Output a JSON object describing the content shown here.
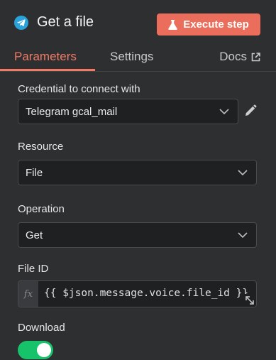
{
  "header": {
    "title": "Get a file",
    "node_icon": "telegram-icon",
    "execute_label": "Execute step",
    "execute_icon": "flask-icon",
    "accent": "#ea6e5b"
  },
  "tabs": [
    {
      "label": "Parameters",
      "active": true
    },
    {
      "label": "Settings",
      "active": false
    }
  ],
  "docs": {
    "label": "Docs",
    "icon": "external-link-icon"
  },
  "fields": {
    "credential": {
      "label": "Credential to connect with",
      "value": "Telegram gcal_mail"
    },
    "resource": {
      "label": "Resource",
      "value": "File"
    },
    "operation": {
      "label": "Operation",
      "value": "Get"
    },
    "file_id": {
      "label": "File ID",
      "fx": "fx",
      "value": "{{ $json.message.voice.file_id }}"
    },
    "download": {
      "label": "Download",
      "enabled": true
    }
  }
}
